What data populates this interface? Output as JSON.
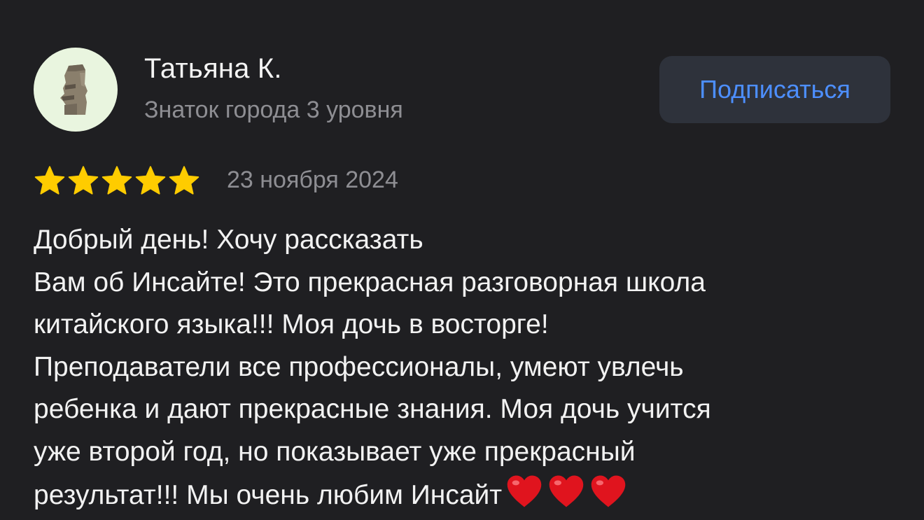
{
  "author": {
    "name": "Татьяна К.",
    "level": "Знаток города 3 уровня",
    "avatar_icon": "moai-statue-icon"
  },
  "actions": {
    "subscribe_label": "Подписаться"
  },
  "review": {
    "rating": 5,
    "rating_max": 5,
    "date": "23 ноября 2024",
    "lines": [
      "Добрый день! Хочу рассказать",
      "Вам об Инсайте! Это прекрасная разговорная школа",
      "китайского языка!!! Моя дочь в восторге!",
      "Преподаватели все профессионалы, умеют увлечь",
      "ребенка и дают прекрасные знания. Моя дочь учится",
      "уже второй год, но показывает уже прекрасный",
      "результат!!! Мы очень любим Инсайт"
    ],
    "trailing_emoji": [
      "heart-icon",
      "heart-icon",
      "heart-icon"
    ]
  },
  "colors": {
    "background": "#1f1f22",
    "star": "#ffcc00",
    "accent": "#4d8fff",
    "button_bg": "#2e323b",
    "secondary_text": "#8e8e93",
    "heart": "#e0141e"
  }
}
